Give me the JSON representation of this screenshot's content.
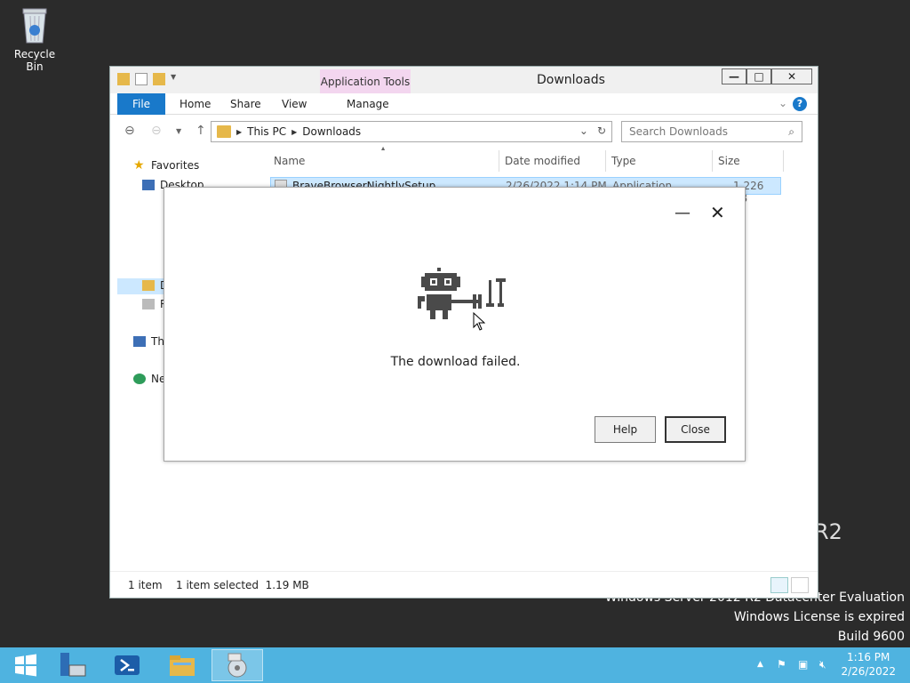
{
  "desktop": {
    "recycle_bin_label": "Recycle Bin",
    "watermark": {
      "line1": "Windows Server 2012 R2 Datacenter Evaluation",
      "line2": "Windows License is expired",
      "line3": "Build 9600"
    }
  },
  "explorer": {
    "title": "Downloads",
    "contextual_tab": "Application Tools",
    "ribbon_tabs": [
      "File",
      "Home",
      "Share",
      "View",
      "Manage"
    ],
    "address": {
      "segments": [
        "This PC",
        "Downloads"
      ]
    },
    "search_placeholder": "Search Downloads",
    "nav": {
      "favorites": "Favorites",
      "desktop": "Desktop",
      "downloads": "D",
      "recent": "R",
      "this_pc": "Th",
      "network": "Ne"
    },
    "columns": [
      "Name",
      "Date modified",
      "Type",
      "Size"
    ],
    "files": [
      {
        "name": "BraveBrowserNightlySetup",
        "date_modified": "2/26/2022 1:14 PM",
        "type": "Application",
        "size": "1,226 KB"
      }
    ],
    "status": {
      "count": "1 item",
      "selection": "1 item selected  1.19 MB"
    }
  },
  "dialog": {
    "message": "The download failed.",
    "help_label": "Help",
    "close_label": "Close",
    "robot_icon": "robot-with-tools-icon"
  },
  "taskbar": {
    "clock_time": "1:16 PM",
    "clock_date": "2/26/2022"
  },
  "colors": {
    "taskbar": "#4fb3e0",
    "ribbon_file": "#1979ca",
    "app_tools": "#f3d6ef",
    "selection": "#cce8ff"
  }
}
